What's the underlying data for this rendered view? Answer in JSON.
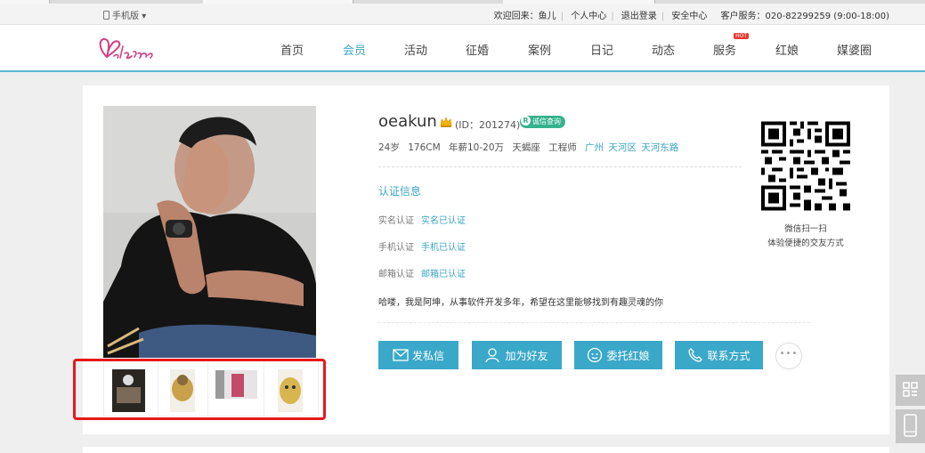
{
  "topbar": {
    "mobile_label": "手机版",
    "links": [
      "欢迎回来：鱼儿",
      "个人中心",
      "退出登录",
      "安全中心"
    ],
    "hotline": "客户服务：020-82299259 (9:00-18:00)"
  },
  "nav": {
    "items": [
      "首页",
      "会员",
      "活动",
      "征婚",
      "案例",
      "日记",
      "动态",
      "服务",
      "红娘",
      "媒婆圈"
    ],
    "active_index": 1,
    "hot_badge": "HOT",
    "accent_color": "#39a9c4"
  },
  "profile": {
    "name": "oeakun",
    "id_text": "(ID：201274)",
    "credit_badge": "诚信查询",
    "basic": [
      "24岁",
      "176CM",
      "年薪10-20万",
      "天蝎座",
      "工程师"
    ],
    "location": [
      "广州",
      "天河区",
      "天河东路"
    ],
    "verify_title": "认证信息",
    "verifications": [
      {
        "label": "实名认证",
        "value": "实名已认证"
      },
      {
        "label": "手机认证",
        "value": "手机已认证"
      },
      {
        "label": "邮箱认证",
        "value": "邮箱已认证"
      }
    ],
    "intro": "哈喽，我是阿坤，从事软件开发多年，希望在这里能够找到有趣灵魂的你"
  },
  "actions": [
    "发私信",
    "加为好友",
    "委托红娘",
    "联系方式"
  ],
  "more_label": "•••",
  "qr": {
    "line1": "微信扫一扫",
    "line2": "体验便捷的交友方式"
  },
  "icons": [
    "phone-icon",
    "crown-icon",
    "mail-icon",
    "add-friend-icon",
    "matchmaker-icon",
    "call-icon",
    "qr-icon",
    "mobile-icon"
  ]
}
